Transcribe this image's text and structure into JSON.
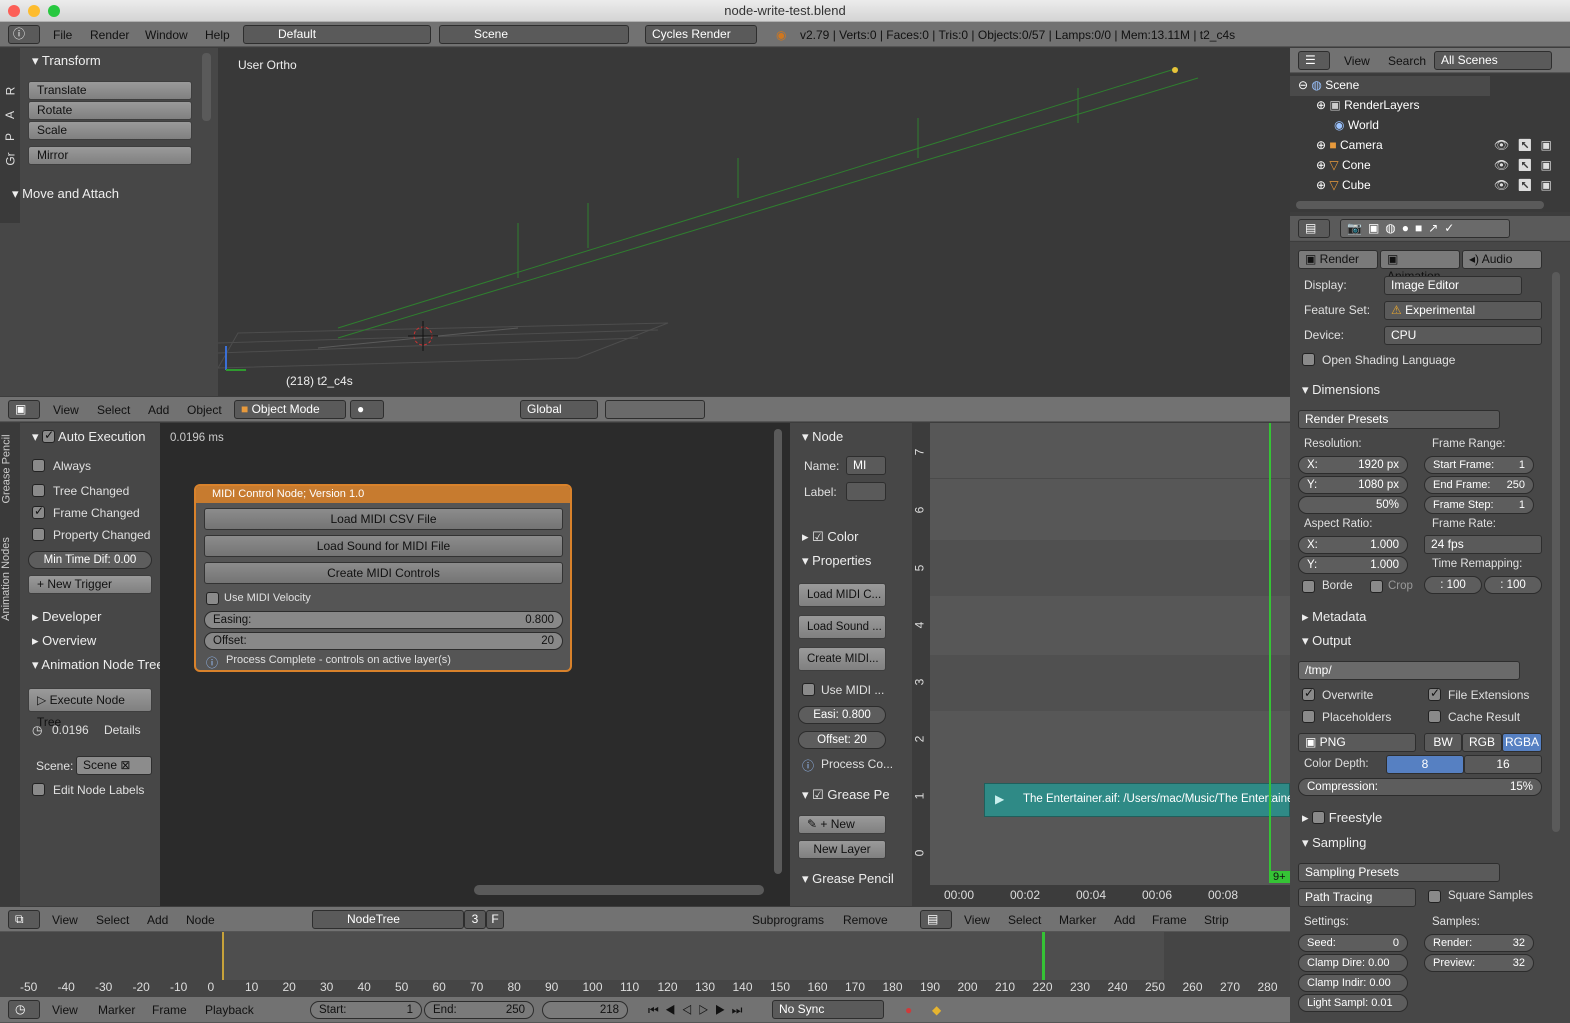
{
  "window": {
    "title": "node-write-test.blend"
  },
  "info_bar": {
    "menus": [
      "File",
      "Render",
      "Window",
      "Help"
    ],
    "layout": "Default",
    "scene": "Scene",
    "engine": "Cycles Render",
    "stats": "v2.79 | Verts:0 | Faces:0 | Tris:0 | Objects:0/57 | Lamps:0/0 | Mem:13.11M | t2_c4s"
  },
  "tool_shelf": {
    "tabs": [
      "R",
      "A",
      "P",
      "Gr"
    ],
    "transform_title": "Transform",
    "buttons": [
      "Translate",
      "Rotate",
      "Scale",
      "Mirror"
    ],
    "move_attach": "Move and Attach"
  },
  "viewport": {
    "label": "User Ortho",
    "object_label": "(218) t2_c4s",
    "menus": [
      "View",
      "Select",
      "Add",
      "Object"
    ],
    "mode": "Object Mode",
    "orientation": "Global"
  },
  "outliner": {
    "menus": [
      "View",
      "Search"
    ],
    "filter": "All Scenes",
    "items": [
      "Scene",
      "RenderLayers",
      "World",
      "Camera",
      "Cone",
      "Cube"
    ]
  },
  "properties": {
    "tabs": [
      "Render",
      "Animation",
      "Audio"
    ],
    "display_label": "Display:",
    "display_value": "Image Editor",
    "feature_label": "Feature Set:",
    "feature_value": "Experimental",
    "device_label": "Device:",
    "device_value": "CPU",
    "osl": "Open Shading Language",
    "dimensions": "Dimensions",
    "render_presets": "Render Presets",
    "resolution": "Resolution:",
    "res_x": "X:",
    "res_x_val": "1920 px",
    "res_y": "Y:",
    "res_y_val": "1080 px",
    "res_pct": "50%",
    "frame_range": "Frame Range:",
    "start_frame": "Start Frame:",
    "start_val": "1",
    "end_frame": "End Frame:",
    "end_val": "250",
    "frame_step": "Frame Step:",
    "step_val": "1",
    "aspect": "Aspect Ratio:",
    "asp_x": "X:",
    "asp_x_val": "1.000",
    "asp_y": "Y:",
    "asp_y_val": "1.000",
    "frame_rate": "Frame Rate:",
    "fps": "24 fps",
    "time_remap": "Time Remapping:",
    "remap_old": ": 100",
    "remap_new": ": 100",
    "border": "Borde",
    "crop": "Crop",
    "metadata": "Metadata",
    "output": "Output",
    "path": "/tmp/",
    "overwrite": "Overwrite",
    "file_ext": "File Extensions",
    "placeholders": "Placeholders",
    "cache": "Cache Result",
    "format": "PNG",
    "bw": "BW",
    "rgb": "RGB",
    "rgba": "RGBA",
    "color_depth": "Color Depth:",
    "depth8": "8",
    "depth16": "16",
    "compression": "Compression:",
    "compression_val": "15%",
    "freestyle": "Freestyle",
    "sampling": "Sampling",
    "sampling_presets": "Sampling Presets",
    "path_tracing": "Path Tracing",
    "square_samples": "Square Samples",
    "settings": "Settings:",
    "samples": "Samples:",
    "seed": "Seed:",
    "seed_val": "0",
    "clamp_direct": "Clamp Dire: 0.00",
    "clamp_indirect": "Clamp Indir: 0.00",
    "light_sample": "Light Sampl: 0.01",
    "render_samples": "Render:",
    "render_samples_val": "32",
    "preview_samples": "Preview:",
    "preview_samples_val": "32"
  },
  "node_sidebar": {
    "tabs": [
      "Grease Pencil",
      "Animation Nodes"
    ],
    "auto_exec": "Auto Execution",
    "always": "Always",
    "tree_changed": "Tree Changed",
    "frame_changed": "Frame Changed",
    "property_changed": "Property Changed",
    "min_time": "Min Time Dif: 0.00",
    "new_trigger": "New Trigger",
    "developer": "Developer",
    "overview": "Overview",
    "anim_tree": "Animation Node Tree",
    "execute": "Execute Node Tree",
    "exec_time": "0.0196",
    "details": "Details",
    "scene_label": "Scene:",
    "scene_value": "Scene",
    "edit_labels": "Edit Node Labels"
  },
  "node_editor": {
    "timing": "0.0196 ms",
    "menus": [
      "View",
      "Select",
      "Add",
      "Node"
    ],
    "tree_name": "NodeTree",
    "users": "3",
    "f": "F",
    "subprograms": "Subprograms",
    "remove": "Remove"
  },
  "midi_node": {
    "title": "MIDI Control Node; Version 1.0",
    "load_csv": "Load MIDI CSV File",
    "load_sound": "Load Sound for MIDI File",
    "create": "Create MIDI Controls",
    "use_velocity": "Use MIDI Velocity",
    "easing": "Easing:",
    "easing_val": "0.800",
    "offset": "Offset:",
    "offset_val": "20",
    "status": "Process Complete - controls on active layer(s)"
  },
  "node_props": {
    "node": "Node",
    "name": "Name:",
    "name_val": "MI",
    "label": "Label:",
    "color": "Color",
    "properties": "Properties",
    "b1": "Load MIDI C...",
    "b2": "Load Sound ...",
    "b3": "Create MIDI...",
    "use": "Use MIDI ...",
    "easi": "Easi: 0.800",
    "off": "Offset:",
    "off_val": "20",
    "proc": "Process Co...",
    "grease": "Grease Pe",
    "new": "New",
    "new_layer": "New Layer",
    "grease2": "Grease Pencil"
  },
  "sequencer": {
    "strip": "The Entertainer.aif: /Users/mac/Music/The Entertainer.a",
    "times": [
      "00:00",
      "00:02",
      "00:04",
      "00:06",
      "00:08"
    ],
    "channels": [
      "7",
      "6",
      "5",
      "4",
      "3",
      "2",
      "1",
      "0"
    ],
    "menus": [
      "View",
      "Select",
      "Marker",
      "Add",
      "Frame",
      "Strip"
    ],
    "frame_badge": "9+"
  },
  "timeline": {
    "ticks": [
      "-50",
      "-40",
      "-30",
      "-20",
      "-10",
      "0",
      "10",
      "20",
      "30",
      "40",
      "50",
      "60",
      "70",
      "80",
      "90",
      "100",
      "110",
      "120",
      "130",
      "140",
      "150",
      "160",
      "170",
      "180",
      "190",
      "200",
      "210",
      "220",
      "230",
      "240",
      "250",
      "260",
      "270",
      "280"
    ],
    "menus": [
      "View",
      "Marker",
      "Frame",
      "Playback"
    ],
    "start_label": "Start:",
    "start": "1",
    "end_label": "End:",
    "end": "250",
    "current": "218",
    "sync": "No Sync"
  }
}
